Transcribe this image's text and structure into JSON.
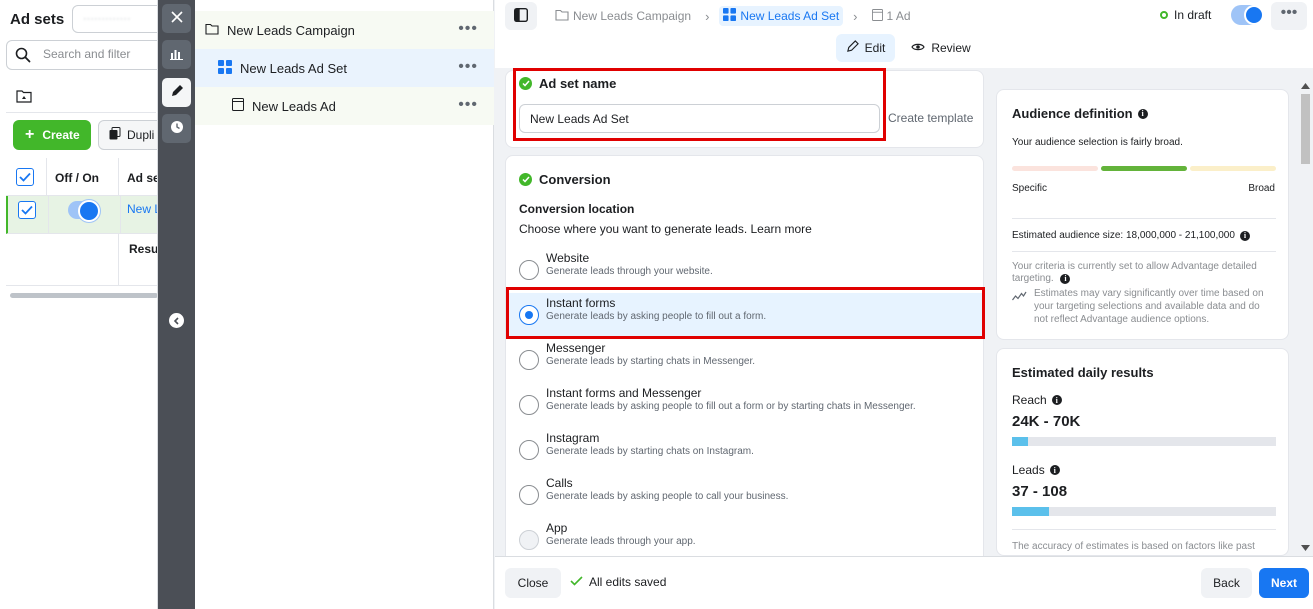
{
  "left_panel": {
    "title": "Ad sets",
    "search_placeholder": "Search and filter",
    "create_label": "Create",
    "duplicate_label": "Dupli",
    "col_off_on": "Off / On",
    "col_ad_set": "Ad se",
    "row_name": "New L",
    "results_label": "Resul"
  },
  "tree": {
    "campaign": "New Leads Campaign",
    "ad_set": "New Leads Ad Set",
    "ad": "New Leads Ad",
    "more": "•••"
  },
  "header": {
    "breadcrumbs": [
      "New Leads Campaign",
      "New Leads Ad Set",
      "1 Ad"
    ],
    "status": "In draft",
    "more": "•••",
    "tab_edit": "Edit",
    "tab_review": "Review"
  },
  "ad_set_name": {
    "title": "Ad set name",
    "value": "New Leads Ad Set",
    "create_template": "Create template"
  },
  "conversion": {
    "title": "Conversion",
    "location_label": "Conversion location",
    "description": "Choose where you want to generate leads. Learn more",
    "selected": "Instant forms",
    "options": [
      {
        "title": "Website",
        "desc": "Generate leads through your website."
      },
      {
        "title": "Instant forms",
        "desc": "Generate leads by asking people to fill out a form."
      },
      {
        "title": "Messenger",
        "desc": "Generate leads by starting chats in Messenger."
      },
      {
        "title": "Instant forms and Messenger",
        "desc": "Generate leads by asking people to fill out a form or by starting chats in Messenger."
      },
      {
        "title": "Instagram",
        "desc": "Generate leads by starting chats on Instagram."
      },
      {
        "title": "Calls",
        "desc": "Generate leads by asking people to call your business."
      },
      {
        "title": "App",
        "desc": "Generate leads through your app."
      }
    ]
  },
  "audience": {
    "title": "Audience definition",
    "summary": "Your audience selection is fairly broad.",
    "specific": "Specific",
    "broad": "Broad",
    "size": "Estimated audience size: 18,000,000 - 21,100,000",
    "criteria": "Your criteria is currently set to allow Advantage detailed targeting.",
    "estimates_note": "Estimates may vary significantly over time based on your targeting selections and available data and do not reflect Advantage audience options.",
    "colors": {
      "specific": "#fbe3dd",
      "mid": "#63b33a",
      "broad": "#fbefc9"
    }
  },
  "daily_results": {
    "title": "Estimated daily results",
    "reach_label": "Reach",
    "reach_value": "24K - 70K",
    "reach_fill": 0.06,
    "leads_label": "Leads",
    "leads_value": "37 - 108",
    "leads_fill": 0.14,
    "accuracy_note": "The accuracy of estimates is based on factors like past"
  },
  "footer": {
    "close": "Close",
    "saved": "All edits saved",
    "back": "Back",
    "next": "Next"
  },
  "colors": {
    "accent": "#1877f2",
    "success": "#42b72a",
    "highlight": "#e00000"
  }
}
